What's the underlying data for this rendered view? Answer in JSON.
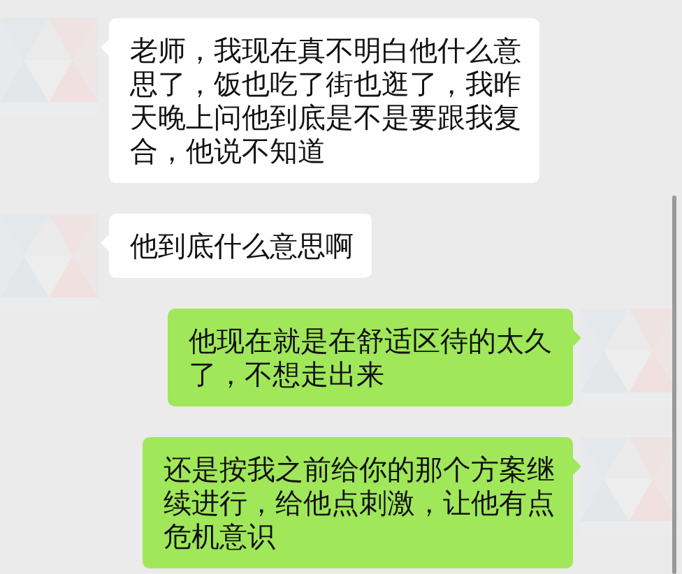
{
  "messages": [
    {
      "kind": "received",
      "text": "老师，我现在真不明白他什么意思了，饭也吃了街也逛了，我昨天晚上问他到底是不是要跟我复合，他说不知道"
    },
    {
      "kind": "received",
      "text": "他到底什么意思啊"
    },
    {
      "kind": "sent",
      "text": "他现在就是在舒适区待的太久了，不想走出来"
    },
    {
      "kind": "sent",
      "text": "还是按我之前给你的那个方案继续进行，给他点刺激，让他有点危机意识"
    }
  ]
}
